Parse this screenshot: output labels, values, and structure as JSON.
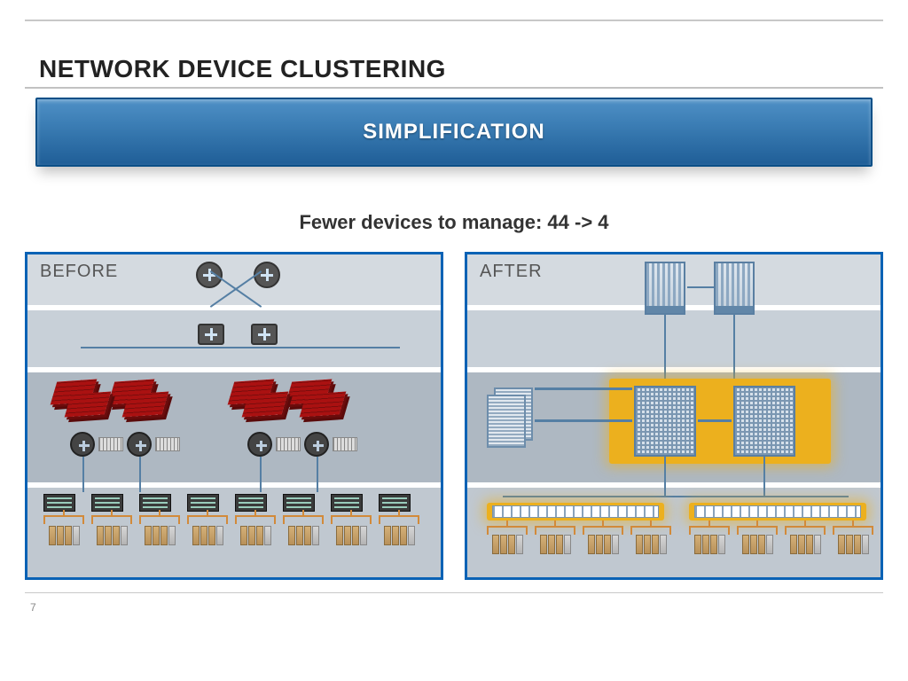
{
  "header": {
    "title": "NETWORK DEVICE CLUSTERING"
  },
  "banner": {
    "label": "SIMPLIFICATION"
  },
  "subhead": "Fewer devices to manage: 44 -> 4",
  "panels": {
    "before": {
      "label": "BEFORE",
      "device_counts": {
        "routers": 2,
        "core_switches": 2,
        "firewall_clusters": 4,
        "distribution_switches": 4,
        "load_balancers": 4,
        "access_switches": 8,
        "server_groups": 8
      }
    },
    "after": {
      "label": "AFTER",
      "device_counts": {
        "core_chassis": 2,
        "aggregation_chassis": 2,
        "side_chassis": 1,
        "rack_switch_strips": 2,
        "server_groups": 8
      }
    }
  },
  "footer": {
    "page_number": "7"
  },
  "colors": {
    "accent_blue": "#0a62b5",
    "banner_gradient_top": "#4f90c6",
    "banner_gradient_bottom": "#1f5e97",
    "highlight_yellow": "#ecb01e",
    "firewall_red": "#a11212"
  }
}
